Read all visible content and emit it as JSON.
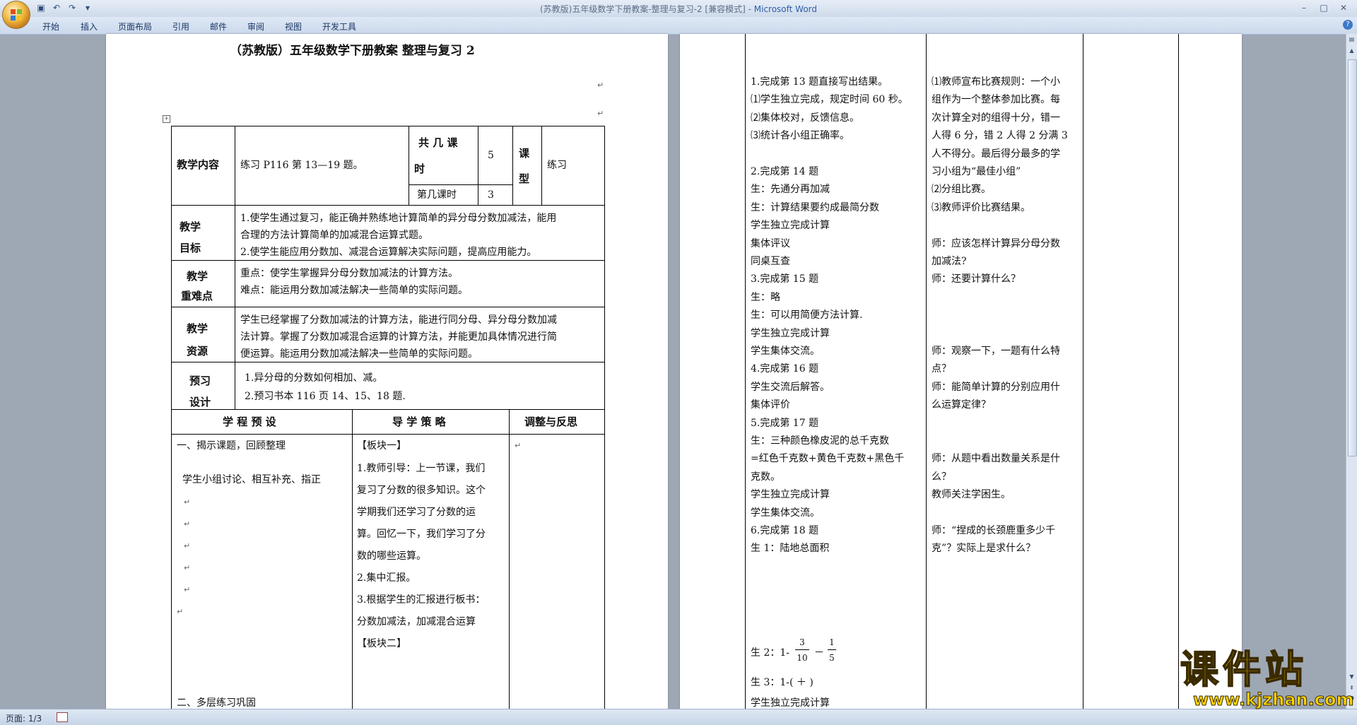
{
  "window": {
    "title": "(苏教版)五年级数学下册教案-整理与复习-2 [兼容模式] - ",
    "app_name": "Microsoft Word",
    "qat_icons": [
      "save-icon",
      "undo-icon",
      "redo-icon",
      "customize-icon"
    ],
    "controls": {
      "minimize": "–",
      "maximize": "□",
      "close": "✕"
    },
    "help": "?"
  },
  "ribbon": {
    "tabs": [
      "开始",
      "插入",
      "页面布局",
      "引用",
      "邮件",
      "审阅",
      "视图",
      "开发工具"
    ]
  },
  "status": {
    "page_count": "页面: 1/3"
  },
  "doc": {
    "title": "（苏教版）五年级数学下册教案  整理与复习  2",
    "p1": {
      "row1": {
        "label": "教学内容",
        "content": "练习 P116 第 13—19 题。",
        "total_label_1": "共 几 课",
        "total_label_2": "时",
        "total_value": "5",
        "which_label": "第几课时",
        "which_value": "3",
        "type_label_1": "课",
        "type_label_2": "型",
        "type_value": "练习"
      },
      "goal": {
        "label_1": "教学",
        "label_2": "目标",
        "lines": [
          "1.使学生通过复习，能正确并熟练地计算简单的异分母分数加减法，能用",
          "合理的方法计算简单的加减混合运算式题。",
          "2.使学生能应用分数加、减混合运算解决实际问题，提高应用能力。"
        ]
      },
      "key": {
        "label_1": "教学",
        "label_2": "重难点",
        "lines": [
          "重点：使学生掌握异分母分数加减法的计算方法。",
          "难点：能运用分数加减法解决一些简单的实际问题。"
        ]
      },
      "resource": {
        "label_1": "教学",
        "label_2": "资源",
        "lines": [
          "学生已经掌握了分数加减法的计算方法，能进行同分母、异分母分数加减",
          "法计算。掌握了分数加减混合运算的计算方法，并能更加具体情况进行简",
          "便运算。能运用分数加减法解决一些简单的实际问题。"
        ]
      },
      "preview": {
        "label_1": "预习",
        "label_2": "设计",
        "lines": [
          "1.异分母的分数如何相加、减。",
          "2.预习书本 116 页 14、15、18 题."
        ]
      },
      "headers": {
        "process": "学 程 预 设",
        "guide": "导 学 策 略",
        "adjust": "调整与反思"
      },
      "col1": [
        "一、揭示课题，回顾整理",
        "学生小组讨论、相互补充、指正",
        "二、多层练习巩固"
      ],
      "col2": [
        "【板块一】",
        "1.教师引导：上一节课，我们",
        "复习了分数的很多知识。这个",
        "学期我们还学习了分数的运",
        "算。回忆一下，我们学习了分",
        "数的哪些运算。",
        "2.集中汇报。",
        "3.根据学生的汇报进行板书：",
        "分数加减法，加减混合运算",
        "【板块二】"
      ]
    },
    "p2": {
      "col1": [
        "1.完成第 13 题直接写出结果。",
        "⑴学生独立完成，规定时间 60 秒。",
        "⑵集体校对，反馈信息。",
        "⑶统计各小组正确率。",
        "",
        "2.完成第 14 题",
        "生：先通分再加减",
        "生：计算结果要约成最简分数",
        "学生独立完成计算",
        "集体评议",
        "同桌互查",
        "3.完成第 15 题",
        "生：略",
        "生：可以用简便方法计算.",
        "    学生独立完成计算",
        "    学生集体交流。",
        "4.完成第 16 题",
        "  学生交流后解答。",
        "  集体评价",
        "5.完成第 17 题",
        "    生：三种颜色橡皮泥的总千克数",
        "=红色千克数+黄色千克数+黑色千",
        "克数。",
        "    学生独立完成计算",
        "    学生集体交流。",
        "6.完成第 18 题",
        "生 1：陆地总面积"
      ],
      "line_sheng2": {
        "prefix": "生 2：1-",
        "f1_num": "3",
        "f1_den": "10",
        "minus": "－",
        "f2_num": "1",
        "f2_den": "5"
      },
      "line_sheng3": "生 3：1-(    ＋   )",
      "col1_last": "    学生独立完成计算",
      "col2": [
        "⑴教师宣布比赛规则：一个小",
        "组作为一个整体参加比赛。每",
        "次计算全对的组得十分，错一",
        "人得 6 分，错 2 人得 2 分满 3",
        "人不得分。最后得分最多的学",
        "习小组为“最佳小组”",
        "⑵分组比赛。",
        "⑶教师评价比赛结果。",
        "",
        "师：应该怎样计算异分母分数",
        "加减法?",
        "师：还要计算什么？",
        "",
        "",
        "",
        "师：观察一下，一题有什么特",
        "点？",
        "师：能简单计算的分别应用什",
        "么运算定律？",
        "",
        "",
        "师：从题中看出数量关系是什",
        "么？",
        "    教师关注学困生。",
        "",
        "师：“捏成的长颈鹿重多少千",
        "克”？实际上是求什么？"
      ]
    }
  },
  "watermark": {
    "title": "课件站",
    "url": "www.kjzhan.com"
  }
}
